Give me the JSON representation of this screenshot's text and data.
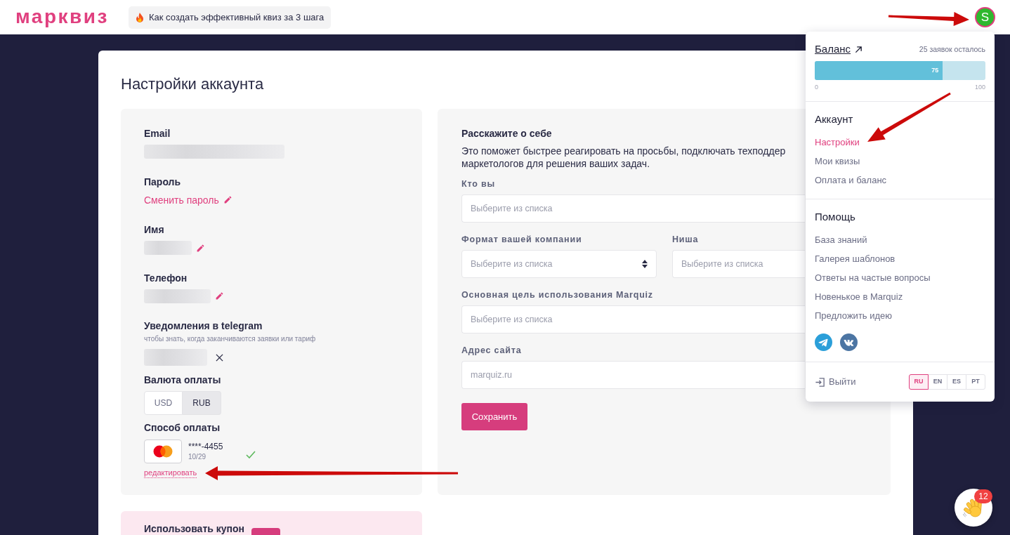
{
  "header": {
    "logo": "марквиз",
    "promo_link": "Как создать эффективный квиз за 3 шага",
    "avatar": "S"
  },
  "page": {
    "title": "Настройки аккаунта"
  },
  "profile": {
    "fields": [
      {
        "label": "Email",
        "kind": "blurred"
      },
      {
        "label": "Пароль",
        "kind": "link",
        "value": "Сменить пароль",
        "editable": true
      },
      {
        "label": "Имя",
        "kind": "blurred",
        "editable": true
      },
      {
        "label": "Телефон",
        "kind": "blurred",
        "editable": true
      },
      {
        "label": "Уведомления в telegram",
        "hint": "чтобы знать, когда заканчиваются заявки или тариф",
        "kind": "blurred",
        "removable": true
      }
    ],
    "currency": {
      "label": "Валюта оплаты",
      "options": [
        {
          "label": "USD",
          "selected": false
        },
        {
          "label": "RUB",
          "selected": true
        }
      ]
    },
    "payment": {
      "label": "Способ оплаты",
      "card_number": "****-4455",
      "expiry": "10/29",
      "verified": true,
      "edit_link": "редактировать"
    }
  },
  "about": {
    "title": "Расскажите о себе",
    "description_lines": [
      "Это поможет быстрее реагировать на просьбы, подключать техподдер",
      "маркетологов для решения ваших задач."
    ],
    "rows": [
      {
        "fields": [
          {
            "label": "Кто вы",
            "kind": "input",
            "placeholder": "Выберите из списка"
          }
        ]
      },
      {
        "fields": [
          {
            "label": "Формат вашей компании",
            "kind": "select",
            "placeholder": "Выберите из списка"
          },
          {
            "label": "Ниша",
            "kind": "input",
            "placeholder": "Выберите из списка"
          }
        ]
      },
      {
        "fields": [
          {
            "label": "Основная цель использования Marquiz",
            "kind": "input",
            "placeholder": "Выберите из списка"
          }
        ]
      },
      {
        "fields": [
          {
            "label": "Адрес сайта",
            "kind": "input",
            "placeholder": "marquiz.ru"
          }
        ]
      }
    ],
    "save_button": "Сохранить"
  },
  "coupon": {
    "title": "Использовать купон"
  },
  "account_menu": {
    "balance": {
      "title": "Баланс",
      "remaining": "25 заявок осталось",
      "level": 0.75,
      "value_label": "75",
      "min_label": "0",
      "max_label": "100"
    },
    "sections": [
      {
        "title": "Аккаунт",
        "items": [
          {
            "label": "Настройки",
            "selected": true
          },
          {
            "label": "Мои квизы",
            "selected": false
          },
          {
            "label": "Оплата и баланс",
            "selected": false
          }
        ]
      },
      {
        "title": "Помощь",
        "items": [
          {
            "label": "База знаний"
          },
          {
            "label": "Галерея шаблонов"
          },
          {
            "label": "Ответы на частые вопросы"
          },
          {
            "label": "Новенькое в Marquiz"
          },
          {
            "label": "Предложить идею"
          }
        ],
        "social": [
          {
            "kind": "telegram"
          },
          {
            "kind": "vk"
          }
        ]
      }
    ],
    "logout": "Выйти",
    "languages": [
      {
        "label": "RU",
        "selected": true
      },
      {
        "label": "EN",
        "selected": false
      },
      {
        "label": "ES",
        "selected": false
      },
      {
        "label": "PT",
        "selected": false
      }
    ]
  },
  "chat": {
    "badge": "12"
  }
}
